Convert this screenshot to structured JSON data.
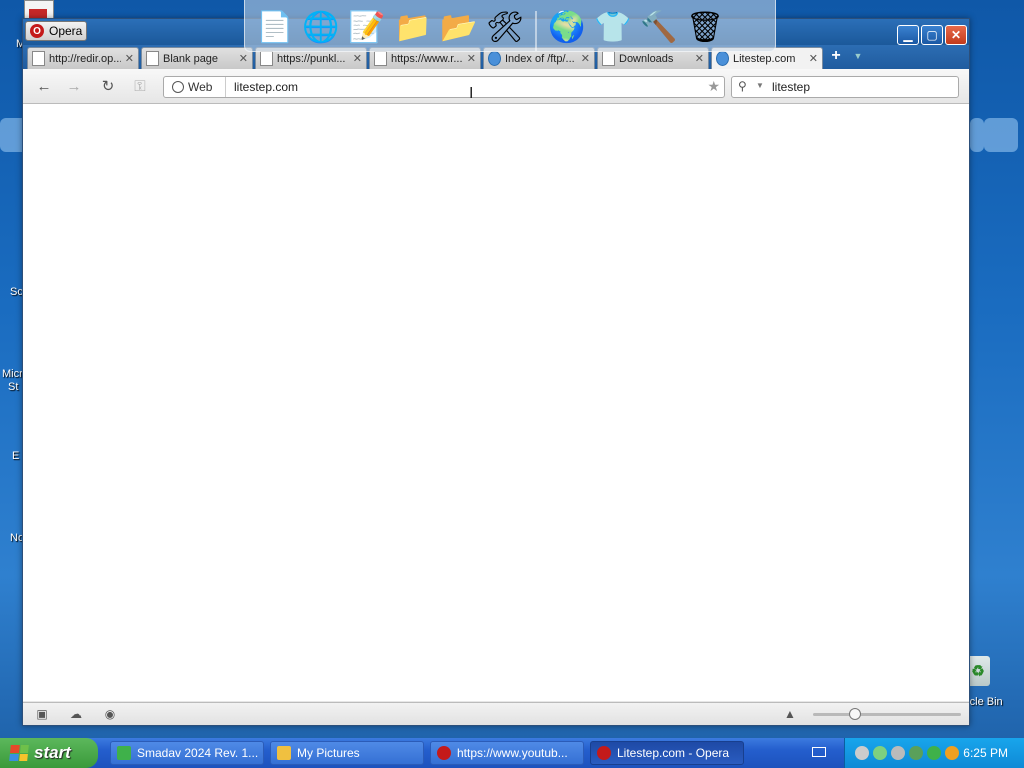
{
  "desktop": {
    "labels_visible": [
      "M",
      "Sc",
      "Micr",
      "St",
      "E",
      "No",
      "rcle Bin"
    ],
    "recycle_bin_label": "rcle Bin"
  },
  "dock": {
    "items": [
      "text-editor-icon",
      "globe-icon",
      "notes-icon",
      "folder-spreadsheet-icon",
      "folder-image-icon",
      "tools-icon",
      "browser-globe-icon",
      "tshirt-icon",
      "hammer-icon",
      "recycle-bin-icon"
    ]
  },
  "browser": {
    "opera_button": "Opera",
    "tabs": [
      {
        "title": "http://redir.op...",
        "icon": "page-icon",
        "active": false
      },
      {
        "title": "Blank page",
        "icon": "page-icon",
        "active": false
      },
      {
        "title": "https://punkl...",
        "icon": "page-icon",
        "active": false
      },
      {
        "title": "https://www.r...",
        "icon": "page-icon",
        "active": false
      },
      {
        "title": "Index of /ftp/...",
        "icon": "loading-icon",
        "active": false
      },
      {
        "title": "Downloads",
        "icon": "downloads-icon",
        "active": false
      },
      {
        "title": "Litestep.com",
        "icon": "globe-icon",
        "active": true
      }
    ],
    "address_bar": {
      "badge": "Web",
      "url": "litestep.com"
    },
    "search_bar": {
      "query": "litestep"
    }
  },
  "taskbar": {
    "start_label": "start",
    "tasks": [
      {
        "label": "Smadav 2024 Rev. 1...",
        "icon": "smadav-icon",
        "color": "#3fb14a",
        "active": false
      },
      {
        "label": "My Pictures",
        "icon": "folder-icon",
        "color": "#f0c040",
        "active": false
      },
      {
        "label": "https://www.youtub...",
        "icon": "opera-icon",
        "color": "#c41a1a",
        "active": false
      },
      {
        "label": "Litestep.com - Opera",
        "icon": "opera-icon",
        "color": "#c41a1a",
        "active": true
      }
    ],
    "clock": "6:25 PM"
  }
}
